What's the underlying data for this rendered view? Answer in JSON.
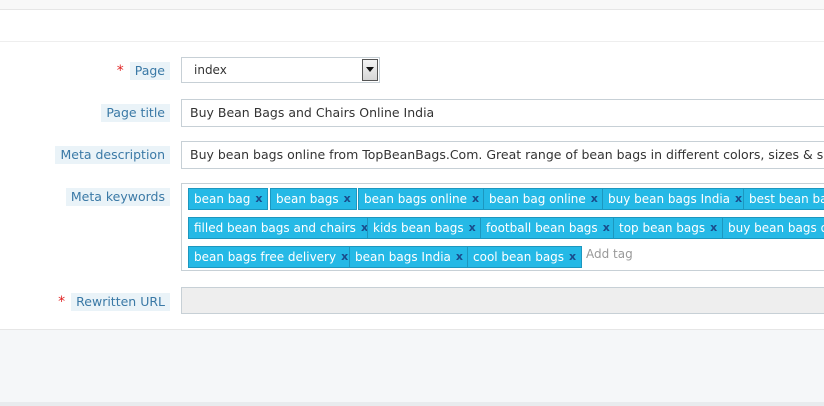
{
  "form": {
    "page": {
      "label": "Page",
      "required": "*",
      "value": "index",
      "arrow_icon": "dropdown-arrow-icon"
    },
    "page_title": {
      "label": "Page title",
      "value": "Buy Bean Bags and Chairs Online India"
    },
    "meta_description": {
      "label": "Meta description",
      "value": "Buy bean bags online from TopBeanBags.Com. Great range of bean bags in different colors, sizes & shapes available"
    },
    "meta_keywords": {
      "label": "Meta keywords",
      "remove_glyph": "x",
      "tags": [
        "bean bag",
        "bean bags",
        "bean bags online",
        "bean bag online",
        "buy bean bags India",
        "best bean bags",
        "filled bean bags and chairs",
        "kids bean bags",
        "football bean bags",
        "top bean bags",
        "buy bean bags online",
        "bean bags free delivery",
        "bean bags India",
        "cool bean bags"
      ],
      "add_placeholder": "Add tag"
    },
    "rewritten_url": {
      "label": "Rewritten URL",
      "required": "*",
      "value": ""
    }
  }
}
